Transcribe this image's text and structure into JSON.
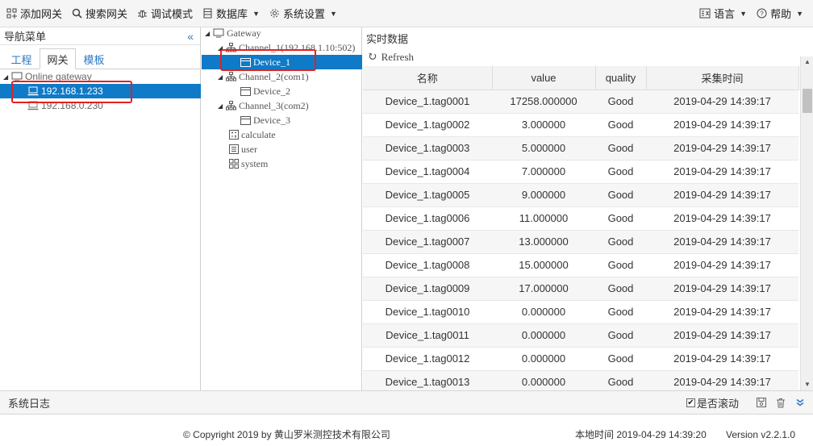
{
  "toolbar": {
    "add_gateway": "添加网关",
    "search_gateway": "搜索网关",
    "debug_mode": "调试模式",
    "database": "数据库",
    "system_settings": "系统设置",
    "language": "语言",
    "help": "帮助"
  },
  "nav": {
    "title": "导航菜单",
    "tabs": [
      {
        "label": "工程"
      },
      {
        "label": "网关"
      },
      {
        "label": "模板"
      }
    ],
    "active_tab": "网关",
    "tree": {
      "root": "Online gateway",
      "items": [
        "192.168.1.233",
        "192.168.0.230"
      ],
      "selected": "192.168.1.233"
    }
  },
  "device_tree": {
    "root": "Gateway",
    "nodes": [
      {
        "label": "Channel_1(192.168.1.10:502)",
        "children": [
          "Device_1"
        ]
      },
      {
        "label": "Channel_2(com1)",
        "children": [
          "Device_2"
        ]
      },
      {
        "label": "Channel_3(com2)",
        "children": [
          "Device_3"
        ]
      }
    ],
    "extra": [
      "calculate",
      "user",
      "system"
    ],
    "selected": "Device_1"
  },
  "realtime": {
    "title": "实时数据",
    "refresh": "Refresh",
    "columns": [
      "名称",
      "value",
      "quality",
      "采集时间"
    ],
    "rows": [
      [
        "Device_1.tag0001",
        "17258.000000",
        "Good",
        "2019-04-29 14:39:17"
      ],
      [
        "Device_1.tag0002",
        "3.000000",
        "Good",
        "2019-04-29 14:39:17"
      ],
      [
        "Device_1.tag0003",
        "5.000000",
        "Good",
        "2019-04-29 14:39:17"
      ],
      [
        "Device_1.tag0004",
        "7.000000",
        "Good",
        "2019-04-29 14:39:17"
      ],
      [
        "Device_1.tag0005",
        "9.000000",
        "Good",
        "2019-04-29 14:39:17"
      ],
      [
        "Device_1.tag0006",
        "11.000000",
        "Good",
        "2019-04-29 14:39:17"
      ],
      [
        "Device_1.tag0007",
        "13.000000",
        "Good",
        "2019-04-29 14:39:17"
      ],
      [
        "Device_1.tag0008",
        "15.000000",
        "Good",
        "2019-04-29 14:39:17"
      ],
      [
        "Device_1.tag0009",
        "17.000000",
        "Good",
        "2019-04-29 14:39:17"
      ],
      [
        "Device_1.tag0010",
        "0.000000",
        "Good",
        "2019-04-29 14:39:17"
      ],
      [
        "Device_1.tag0011",
        "0.000000",
        "Good",
        "2019-04-29 14:39:17"
      ],
      [
        "Device_1.tag0012",
        "0.000000",
        "Good",
        "2019-04-29 14:39:17"
      ],
      [
        "Device_1.tag0013",
        "0.000000",
        "Good",
        "2019-04-29 14:39:17"
      ]
    ]
  },
  "log": {
    "title": "系统日志",
    "autoscroll_label": "是否滚动",
    "autoscroll_checked": true
  },
  "status": {
    "copyright": "© Copyright 2019 by 黄山罗米测控技术有限公司",
    "local_time": "本地时间 2019-04-29 14:39:20",
    "version": "Version v2.2.1.0"
  },
  "colors": {
    "selection": "#0f7ac8",
    "highlight_box": "#e5201f",
    "tab_link": "#2b78c5"
  }
}
